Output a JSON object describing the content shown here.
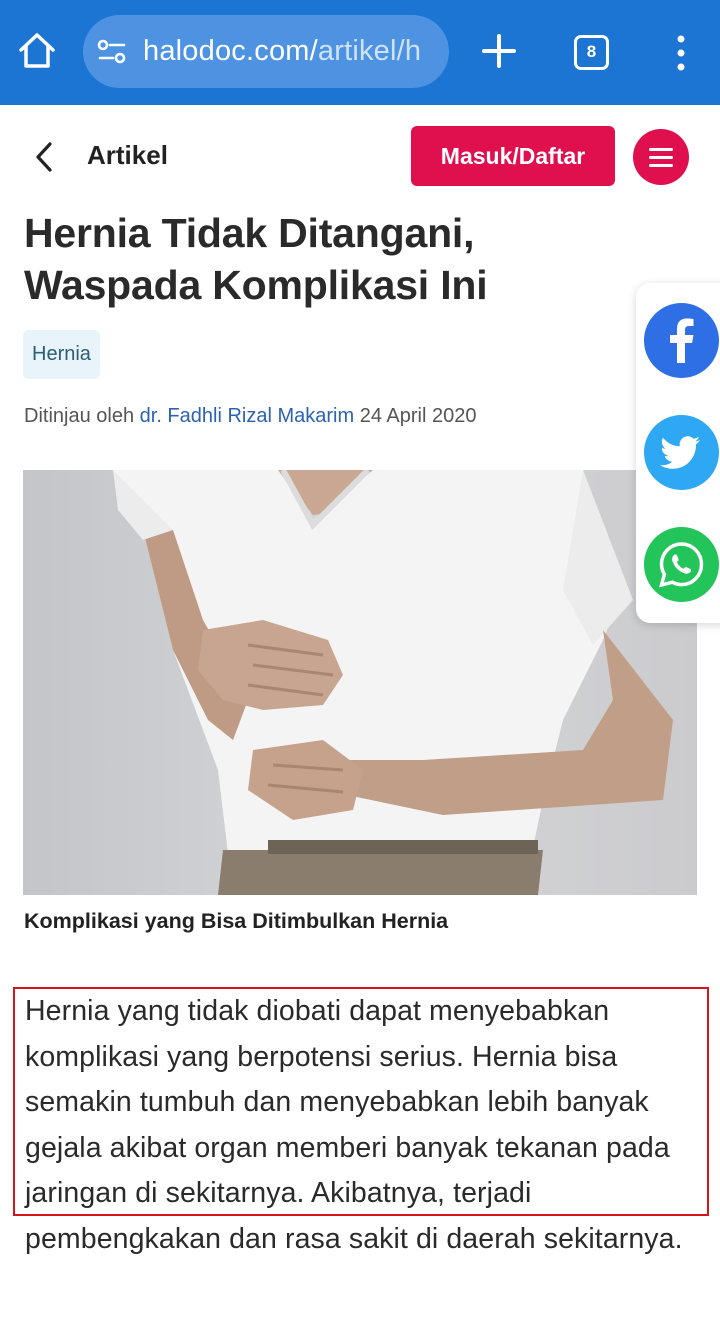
{
  "browser": {
    "url_main": "halodoc.com/",
    "url_faded": "artikel/h",
    "tab_count": "8"
  },
  "header": {
    "title": "Artikel",
    "login_label": "Masuk/Daftar"
  },
  "article": {
    "title": "Hernia Tidak Ditangani, Waspada Komplikasi Ini",
    "tag": "Hernia",
    "reviewed_by_label": "Ditinjau oleh",
    "reviewer": "dr. Fadhli Rizal Makarim",
    "date": "24 April 2020",
    "image_caption": "Komplikasi yang Bisa Ditimbulkan Hernia",
    "body": "Hernia yang tidak diobati dapat menyebabkan komplikasi yang berpotensi serius. Hernia bisa semakin tumbuh dan menyebabkan lebih banyak gejala akibat organ memberi banyak tekanan pada jaringan di sekitarnya. Akibatnya, terjadi pembengkakan dan rasa sakit di daerah sekitarnya."
  },
  "share": [
    "facebook-icon",
    "twitter-icon",
    "whatsapp-icon"
  ],
  "colors": {
    "browser_bar": "#1c74d3",
    "brand_pink": "#e0104f",
    "facebook": "#2f6fe6",
    "twitter": "#2ea8f2",
    "whatsapp": "#23c45a",
    "highlight_border": "#d5151d"
  }
}
